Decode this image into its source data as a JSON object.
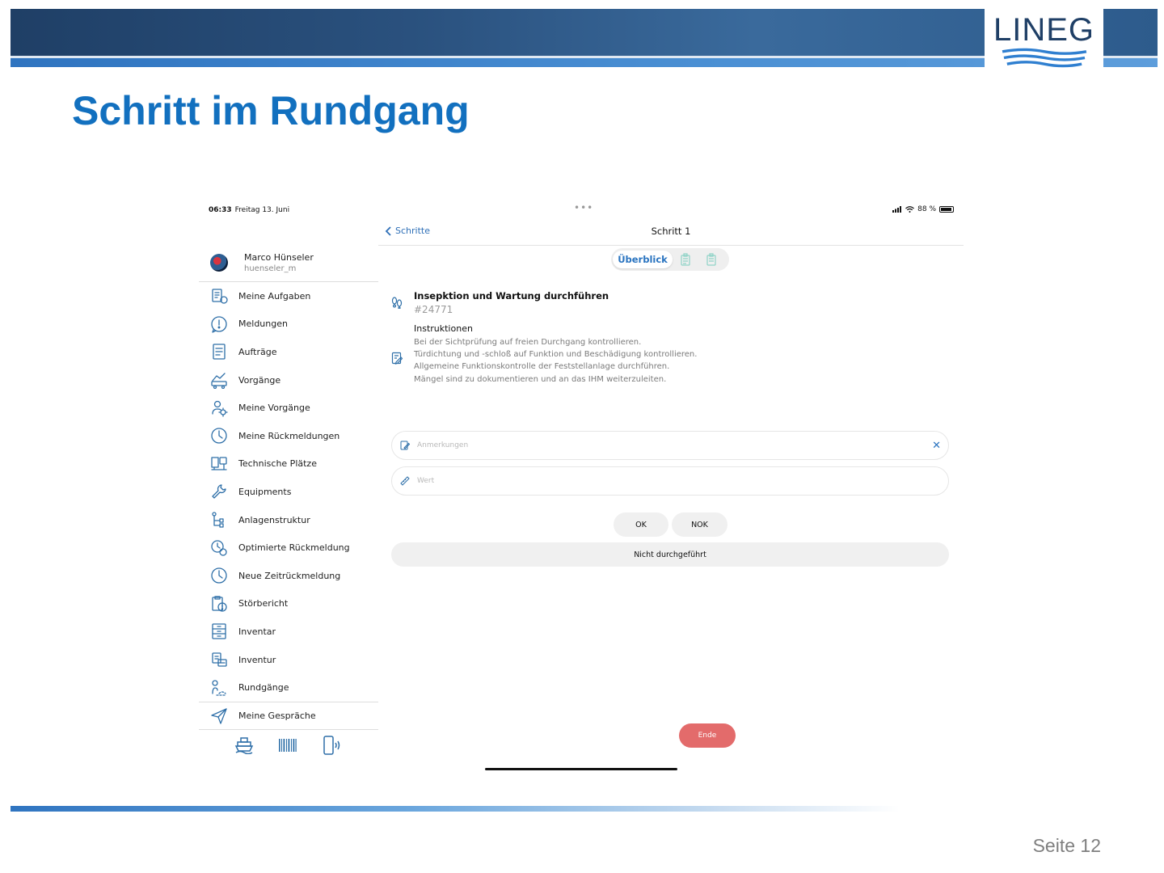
{
  "slide": {
    "logo": "LINEG",
    "title": "Schritt im Rundgang",
    "page": "Seite 12"
  },
  "status_bar": {
    "time": "06:33",
    "date": "Freitag 13. Juni",
    "dots": "•••",
    "battery": "88 %"
  },
  "sidebar": {
    "user_name": "Marco Hünseler",
    "user_id": "huenseler_m",
    "items": [
      {
        "label": "Meine Aufgaben",
        "icon": "tasks-icon"
      },
      {
        "label": "Meldungen",
        "icon": "message-alert-icon"
      },
      {
        "label": "Aufträge",
        "icon": "order-list-icon"
      },
      {
        "label": "Vorgänge",
        "icon": "process-icon"
      },
      {
        "label": "Meine Vorgänge",
        "icon": "my-process-icon"
      },
      {
        "label": "Meine Rückmeldungen",
        "icon": "clock-icon"
      },
      {
        "label": "Technische Plätze",
        "icon": "technical-place-icon"
      },
      {
        "label": "Equipments",
        "icon": "wrench-icon"
      },
      {
        "label": "Anlagenstruktur",
        "icon": "hierarchy-icon"
      },
      {
        "label": "Optimierte Rückmeldung",
        "icon": "optimized-feedback-icon"
      },
      {
        "label": "Neue Zeitrückmeldung",
        "icon": "clock-icon"
      },
      {
        "label": "Störbericht",
        "icon": "fault-report-icon"
      },
      {
        "label": "Inventar",
        "icon": "cabinet-icon"
      },
      {
        "label": "Inventur",
        "icon": "inventory-icon"
      },
      {
        "label": "Rundgänge",
        "icon": "route-icon"
      },
      {
        "label": "Meine Gespräche",
        "icon": "send-icon"
      }
    ],
    "footer_icons": [
      "ship-icon",
      "barcode-icon",
      "nfc-phone-icon"
    ]
  },
  "main": {
    "back_label": "Schritte",
    "title": "Schritt 1",
    "segment_active": "Überblick",
    "operation_title": "Insepktion und Wartung durchführen",
    "operation_id": "#24771",
    "instructions_heading": "Instruktionen",
    "instructions": [
      "Bei der Sichtprüfung auf freien Durchgang kontrollieren.",
      "Türdichtung und -schloß auf Funktion und Beschädigung kontrollieren.",
      "Allgemeine Funktionskontrolle der Feststellanlage durchführen.",
      "Mängel sind zu dokumentieren und an das IHM weiterzuleiten."
    ],
    "remarks_placeholder": "Anmerkungen",
    "value_placeholder": "Wert",
    "ok_label": "OK",
    "nok_label": "NOK",
    "not_done_label": "Nicht durchgeführt",
    "end_label": "Ende"
  },
  "colors": {
    "brand_blue": "#1270bf",
    "accent": "#2a74c0",
    "end_button": "#e36b6b"
  }
}
